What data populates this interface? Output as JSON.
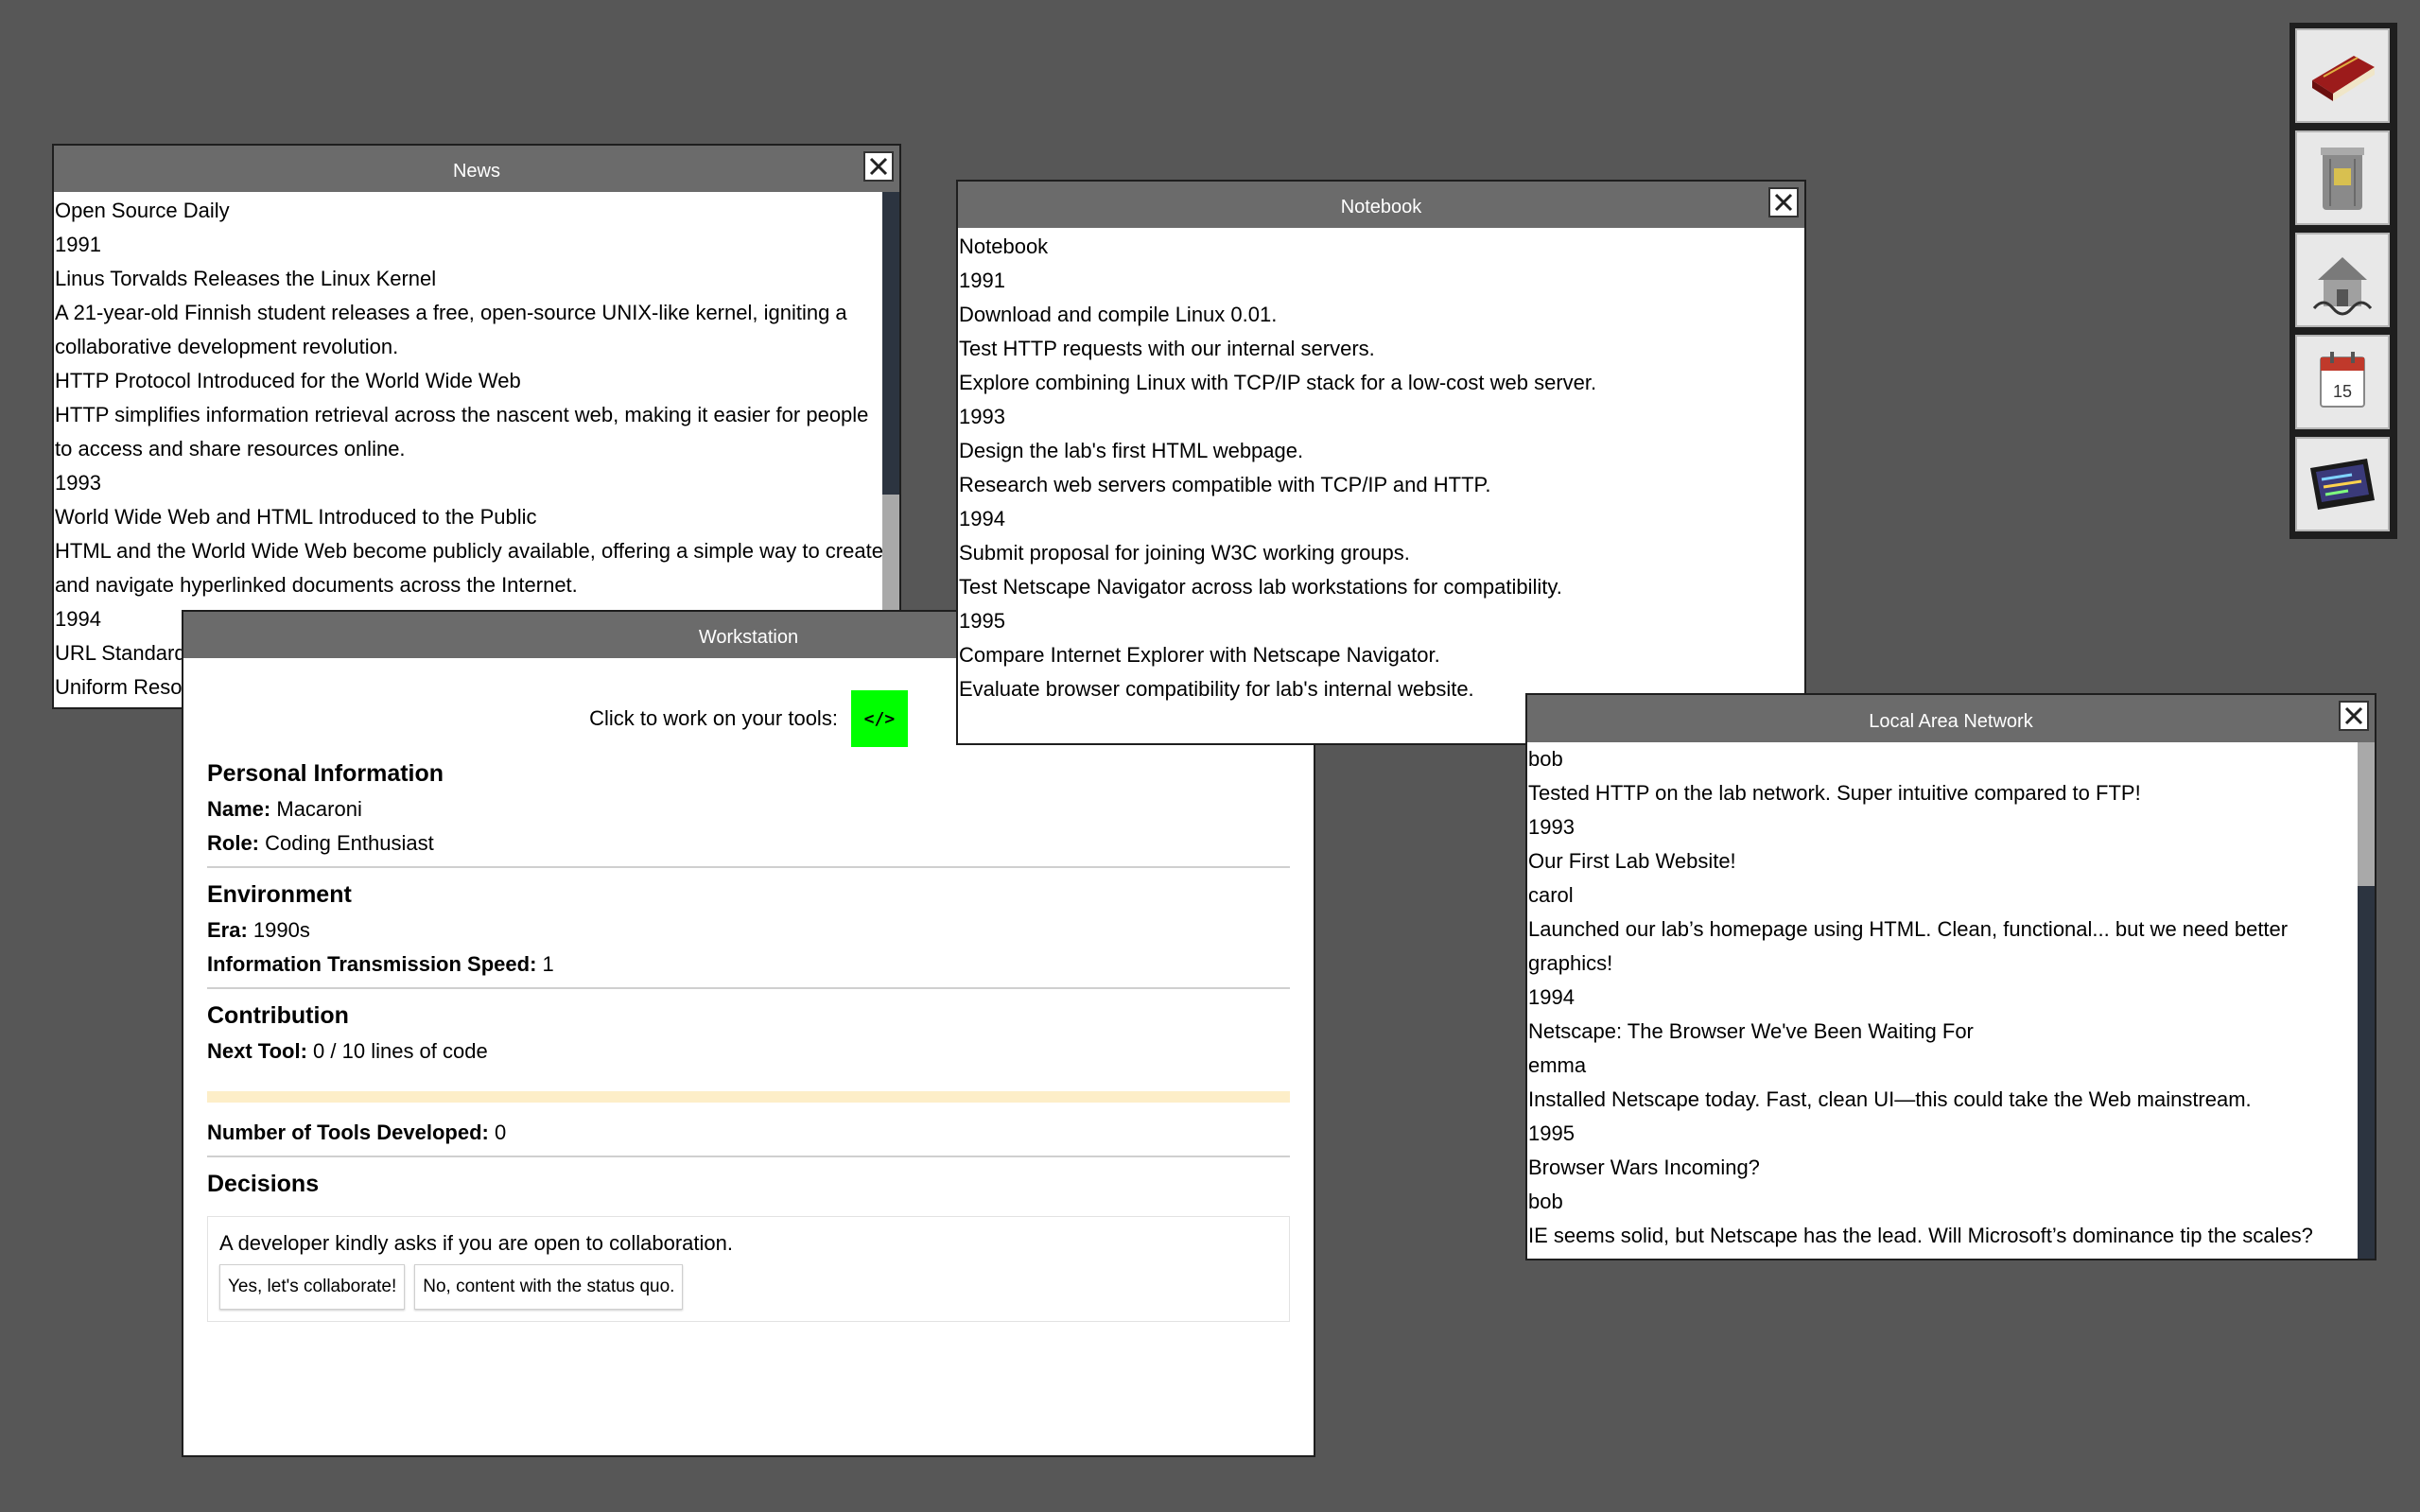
{
  "news": {
    "title": "News",
    "lines": [
      "Open Source Daily",
      "1991",
      "Linus Torvalds Releases the Linux Kernel",
      "A 21-year-old Finnish student releases a free, open-source UNIX-like kernel, igniting a collaborative development revolution.",
      "HTTP Protocol Introduced for the World Wide Web",
      "HTTP simplifies information retrieval across the nascent web, making it easier for people to access and share resources online.",
      "1993",
      "World Wide Web and HTML Introduced to the Public",
      "HTML and the World Wide Web become publicly available, offering a simple way to create and navigate hyperlinked documents across the Internet.",
      "1994",
      "URL Standard",
      "Uniform Reso"
    ]
  },
  "notebook": {
    "title": "Notebook",
    "lines": [
      "Notebook",
      "1991",
      "Download and compile Linux 0.01.",
      "Test HTTP requests with our internal servers.",
      "Explore combining Linux with TCP/IP stack for a low-cost web server.",
      "1993",
      "Design the lab's first HTML webpage.",
      "Research web servers compatible with TCP/IP and HTTP.",
      "1994",
      "Submit proposal for joining W3C working groups.",
      "Test Netscape Navigator across lab workstations for compatibility.",
      "1995",
      "Compare Internet Explorer with Netscape Navigator.",
      "Evaluate browser compatibility for lab's internal website."
    ]
  },
  "lan": {
    "title": "Local Area Network",
    "lines": [
      "bob",
      "Tested HTTP on the lab network. Super intuitive compared to FTP!",
      "1993",
      "Our First Lab Website!",
      "carol",
      "Launched our lab’s homepage using HTML. Clean, functional... but we need better graphics!",
      "1994",
      "Netscape: The Browser We've Been Waiting For",
      "emma",
      "Installed Netscape today. Fast, clean UI—this could take the Web mainstream.",
      "1995",
      "Browser Wars Incoming?",
      "bob",
      "IE seems solid, but Netscape has the lead. Will Microsoft’s dominance tip the scales?"
    ]
  },
  "workstation": {
    "title": "Workstation",
    "tools_prompt": "Click to work on your tools:",
    "tool_button_glyph": "</>",
    "personal": {
      "heading": "Personal Information",
      "name_label": "Name:",
      "name_value": "Macaroni",
      "role_label": "Role:",
      "role_value": "Coding Enthusiast"
    },
    "environment": {
      "heading": "Environment",
      "era_label": "Era:",
      "era_value": "1990s",
      "speed_label": "Information Transmission Speed:",
      "speed_value": "1"
    },
    "contribution": {
      "heading": "Contribution",
      "next_tool_label": "Next Tool:",
      "next_tool_value": "0 / 10 lines of code",
      "progress_fraction": 0,
      "tools_developed_label": "Number of Tools Developed:",
      "tools_developed_value": "0"
    },
    "decisions": {
      "heading": "Decisions",
      "prompt": "A developer kindly asks if you are open to collaboration.",
      "accept_label": "Yes, let's collaborate!",
      "decline_label": "No, content with the status quo."
    }
  },
  "dock": {
    "items": [
      {
        "icon": "book-icon"
      },
      {
        "icon": "paper-bin-icon"
      },
      {
        "icon": "network-house-icon"
      },
      {
        "icon": "calendar-icon",
        "text": "15"
      },
      {
        "icon": "terminal-icon"
      }
    ]
  },
  "colors": {
    "desktop": "#575757",
    "titlebar": "#6b6b6b",
    "tool_button": "#00ff00",
    "progress_track": "#fdeec8"
  }
}
